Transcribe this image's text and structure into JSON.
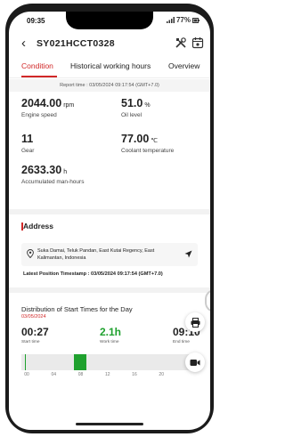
{
  "status_bar": {
    "time": "09:35",
    "battery": "77%"
  },
  "header": {
    "title": "SY021HCCT0328"
  },
  "tabs": [
    "Condition",
    "Historical working hours",
    "Overview"
  ],
  "report": {
    "text": "Report time : 03/05/2024 09:17:54 (GMT+7.0)"
  },
  "metrics": [
    {
      "value": "2044.00",
      "unit": "rpm",
      "label": "Engine speed"
    },
    {
      "value": "51.0",
      "unit": "%",
      "label": "Oil level"
    },
    {
      "value": "11",
      "unit": "",
      "label": "Gear"
    },
    {
      "value": "77.00",
      "unit": "℃",
      "label": "Coolant temperature"
    },
    {
      "value": "2633.30",
      "unit": "h",
      "label": "Accumulated man-hours"
    }
  ],
  "address": {
    "title": "Address",
    "text": "Suka Damai, Teluk Pandan, East Kutai Regency, East Kalimantan, Indonesia",
    "timestamp": "Latest Position Timestamp : 03/05/2024 09:17:54 (GMT+7.0)"
  },
  "distribution": {
    "title": "Distribution of Start Times for the Day",
    "date": "03/05/2024",
    "start_time": {
      "value": "00:27",
      "label": "Start time"
    },
    "work_time": {
      "value": "2.1h",
      "label": "Work time"
    },
    "end_time": {
      "value": "09:10",
      "label": "End time"
    },
    "ticks": [
      "00",
      "04",
      "08",
      "12",
      "16",
      "20"
    ],
    "segments": [
      {
        "start": 0.45,
        "end": 0.55
      },
      {
        "start": 7.5,
        "end": 9.17
      }
    ]
  },
  "colors": {
    "accent": "#d12828",
    "green": "#1fa12e"
  },
  "icons": [
    "back-arrow-icon",
    "tools-icon",
    "calendar-icon",
    "location-pin-icon",
    "navigate-icon",
    "printer-icon",
    "video-camera-icon"
  ]
}
